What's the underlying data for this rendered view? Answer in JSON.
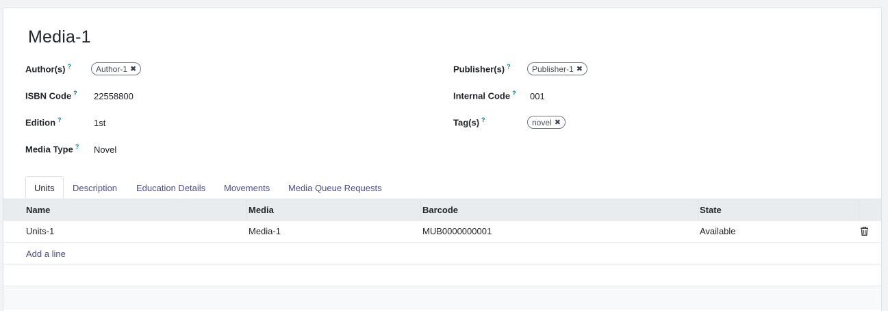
{
  "record": {
    "title": "Media-1"
  },
  "fields": {
    "authors_label": "Author(s)",
    "authors_tags": [
      "Author-1"
    ],
    "isbn_label": "ISBN Code",
    "isbn_value": "22558800",
    "edition_label": "Edition",
    "edition_value": "1st",
    "media_type_label": "Media Type",
    "media_type_value": "Novel",
    "publishers_label": "Publisher(s)",
    "publishers_tags": [
      "Publisher-1"
    ],
    "internal_code_label": "Internal Code",
    "internal_code_value": "001",
    "tags_label": "Tag(s)",
    "tags_tags": [
      "novel"
    ],
    "help_mark": "?",
    "remove_mark": "✖"
  },
  "tabs": [
    {
      "label": "Units",
      "active": true
    },
    {
      "label": "Description",
      "active": false
    },
    {
      "label": "Education Details",
      "active": false
    },
    {
      "label": "Movements",
      "active": false
    },
    {
      "label": "Media Queue Requests",
      "active": false
    }
  ],
  "table": {
    "columns": [
      "Name",
      "Media",
      "Barcode",
      "State"
    ],
    "rows": [
      {
        "name": "Units-1",
        "media": "Media-1",
        "barcode": "MUB0000000001",
        "state": "Available"
      }
    ],
    "add_line_label": "Add a line",
    "row_action_icon": "trash-icon"
  },
  "colors": {
    "link": "#4c4c8a",
    "help": "#017e84",
    "header_bg": "#e9ecef"
  }
}
